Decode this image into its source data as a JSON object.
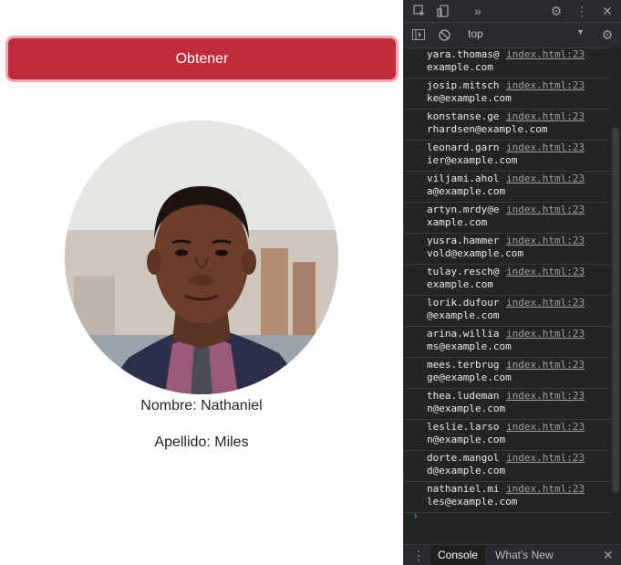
{
  "page": {
    "button_label": "Obtener",
    "first_name_label": "Nombre:",
    "first_name": "Nathaniel",
    "last_name_label": "Apellido:",
    "last_name": "Miles"
  },
  "devtools": {
    "toolbar_icons": [
      "inspect-icon",
      "device-toggle-icon",
      "more-tabs-icon",
      "settings-icon",
      "kebab-menu-icon",
      "close-icon"
    ],
    "context": "top",
    "logs": [
      {
        "msg": "yara.thomas@\nexample.com",
        "src": "index.html:23"
      },
      {
        "msg": "josip.mitsch\nke@example.com",
        "src": "index.html:23"
      },
      {
        "msg": "konstanse.ge\nrhardsen@example.com",
        "src": "index.html:23"
      },
      {
        "msg": "leonard.garn\nier@example.com",
        "src": "index.html:23"
      },
      {
        "msg": "viljami.ahol\na@example.com",
        "src": "index.html:23"
      },
      {
        "msg": "artyn.mrdy@e\nxample.com",
        "src": "index.html:23"
      },
      {
        "msg": "yusra.hammer\nvold@example.com",
        "src": "index.html:23"
      },
      {
        "msg": "tulay.resch@\nexample.com",
        "src": "index.html:23"
      },
      {
        "msg": "lorik.dufour\n@example.com",
        "src": "index.html:23"
      },
      {
        "msg": "arina.willia\nms@example.com",
        "src": "index.html:23"
      },
      {
        "msg": "mees.terbrug\nge@example.com",
        "src": "index.html:23"
      },
      {
        "msg": "thea.ludeman\nn@example.com",
        "src": "index.html:23"
      },
      {
        "msg": "leslie.larso\nn@example.com",
        "src": "index.html:23"
      },
      {
        "msg": "dorte.mangol\nd@example.com",
        "src": "index.html:23"
      },
      {
        "msg": "nathaniel.mi\nles@example.com",
        "src": "index.html:23"
      }
    ],
    "prompt": "›",
    "drawer": {
      "console_tab": "Console",
      "whatsnew_tab": "What's New"
    }
  },
  "colors": {
    "button_bg": "#c02c3b",
    "devtools_bg": "#242424",
    "link_blue": "#4f9dff"
  }
}
